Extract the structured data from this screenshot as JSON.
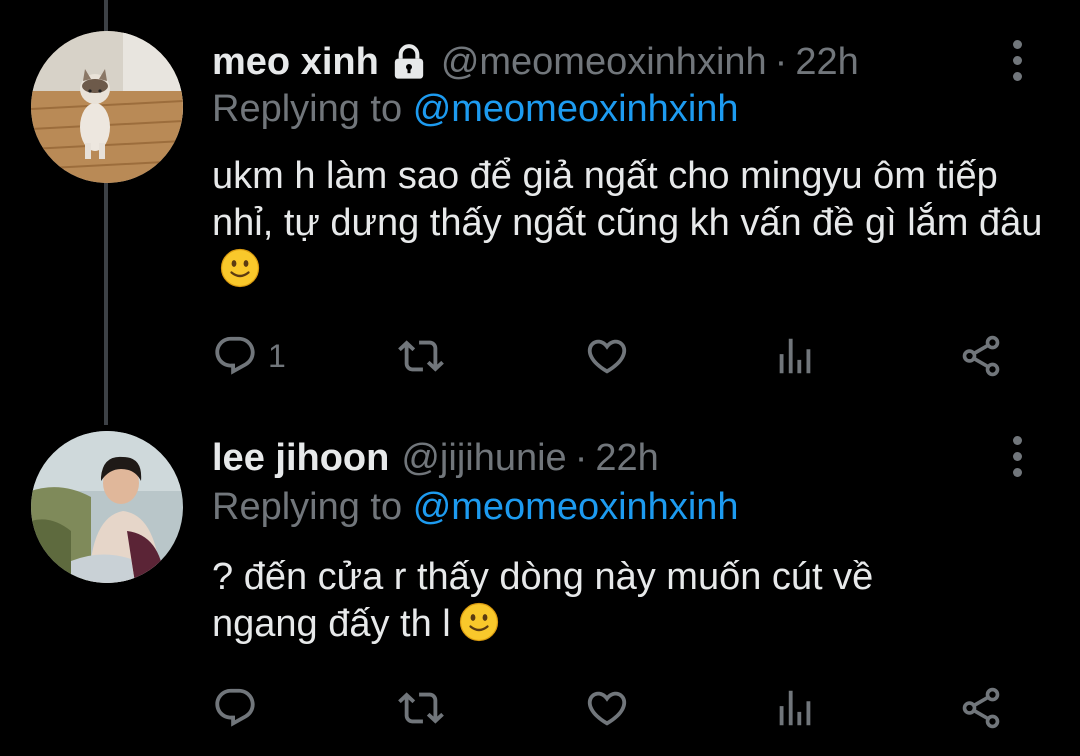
{
  "colors": {
    "background": "#000000",
    "text_primary": "#e7e9ea",
    "text_secondary": "#71767b",
    "accent": "#1d9bf0",
    "thread_line": "#3d4146"
  },
  "tweets": [
    {
      "display_name": "meo xinh",
      "protected_icon": "lock-icon",
      "handle": "@meomeoxinhxinh",
      "separator": "·",
      "time": "22h",
      "replying_prefix": "Replying to",
      "replying_handle": "@meomeoxinhxinh",
      "text": "ukm h làm sao để giả ngất cho mingyu ôm tiếp nhỉ, tự dưng thấy ngất cũng kh vấn đề gì lắm đâu",
      "emoji": "slightly-smiling-face",
      "reply_count": "1",
      "retweet_count": "",
      "like_count": ""
    },
    {
      "display_name": "lee jihoon",
      "handle": "@jijihunie",
      "separator": "·",
      "time": "22h",
      "replying_prefix": "Replying to",
      "replying_handle": "@meomeoxinhxinh",
      "text": "? đến cửa r thấy dòng này muốn cút về ngang đấy th l",
      "emoji": "slightly-smiling-face",
      "reply_count": "",
      "retweet_count": "",
      "like_count": ""
    }
  ],
  "icons": {
    "reply": "reply-icon",
    "retweet": "retweet-icon",
    "like": "like-icon",
    "analytics": "analytics-icon",
    "share": "share-icon",
    "more": "more-options-icon"
  }
}
